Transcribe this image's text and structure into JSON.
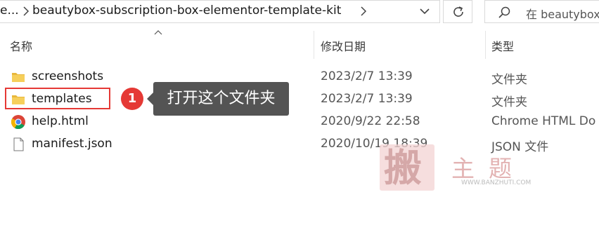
{
  "address_bar": {
    "prefix": "e...",
    "path": "beautybox-subscription-box-elementor-template-kit"
  },
  "search": {
    "placeholder": "在 beautybox"
  },
  "columns": {
    "name": "名称",
    "modified": "修改日期",
    "type": "类型"
  },
  "files": [
    {
      "name": "screenshots",
      "modified": "2023/2/7 13:39",
      "type": "文件夹",
      "icon": "folder-icon"
    },
    {
      "name": "templates",
      "modified": "2023/2/7 13:39",
      "type": "文件夹",
      "icon": "folder-icon"
    },
    {
      "name": "help.html",
      "modified": "2020/9/22 22:58",
      "type": "Chrome HTML Do",
      "icon": "chrome-icon"
    },
    {
      "name": "manifest.json",
      "modified": "2020/10/19 18:39",
      "type": "JSON 文件",
      "icon": "file-icon"
    }
  ],
  "callout": {
    "step": "1",
    "text": "打开这个文件夹",
    "color": "#e53935",
    "tooltip_bg": "#545454"
  },
  "watermark": {
    "seal_char": "搬",
    "text": "主题",
    "url": "WWW.BANZHUTI.COM"
  }
}
